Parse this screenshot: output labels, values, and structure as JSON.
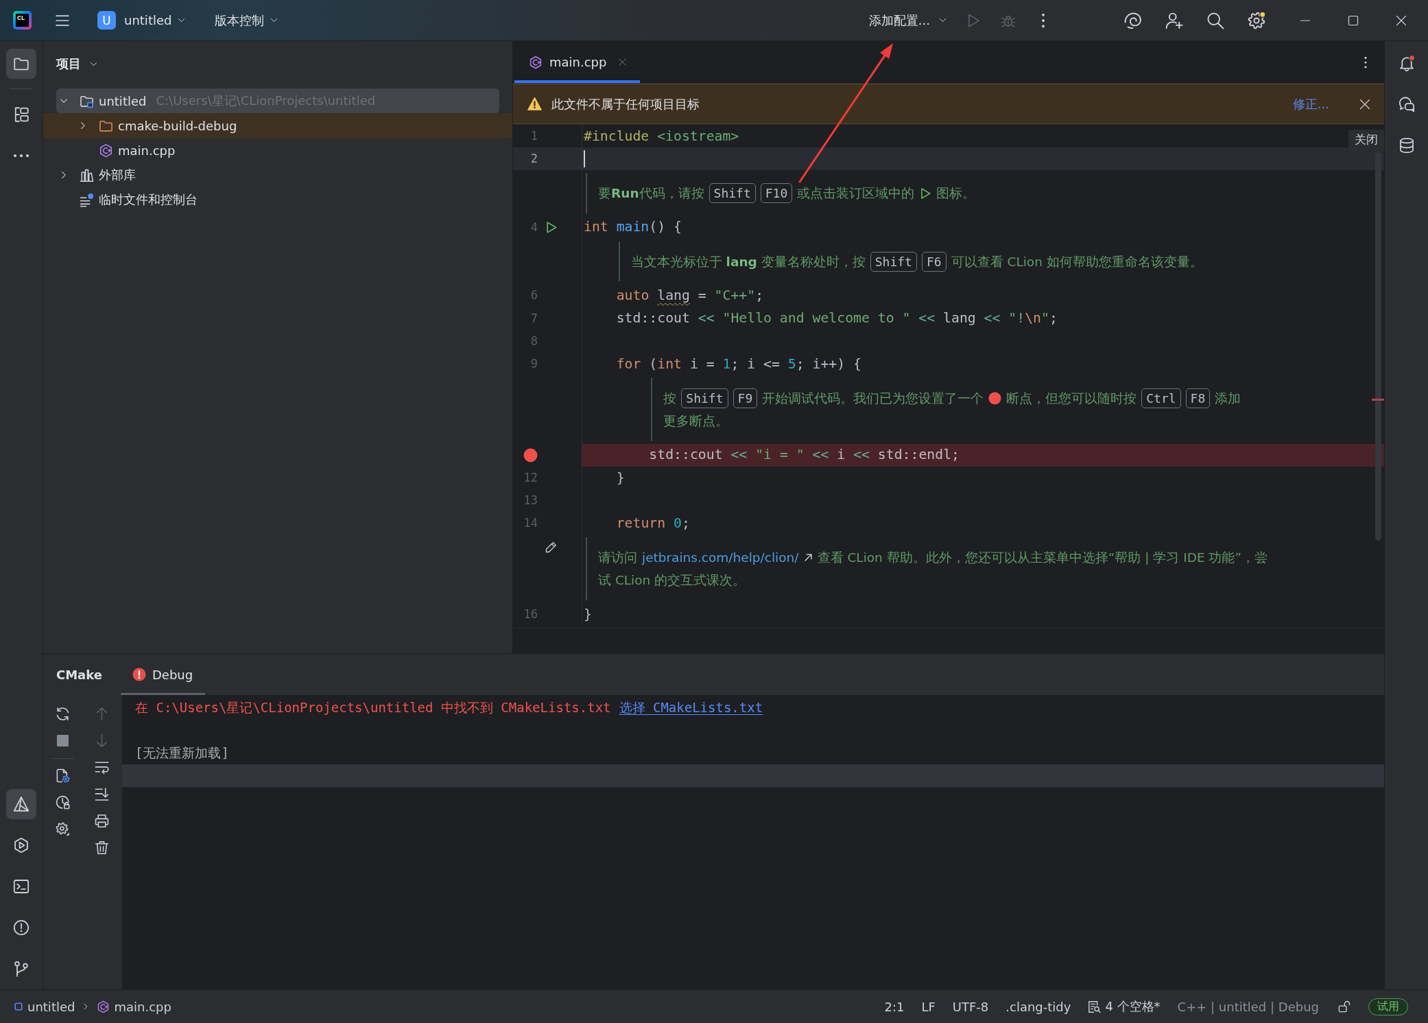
{
  "title_bar": {
    "logo_text": "CL",
    "project_badge": "U",
    "project_name": "untitled",
    "vcs_menu": "版本控制",
    "run_config": "添加配置...",
    "actions": [
      {
        "kind": "run",
        "disabled": true
      },
      {
        "kind": "debug",
        "disabled": true
      },
      {
        "kind": "more"
      }
    ],
    "tools": [
      {
        "kind": "ai",
        "badge": false
      },
      {
        "kind": "add-user",
        "badge": false
      },
      {
        "kind": "search",
        "badge": false
      },
      {
        "kind": "settings",
        "badge": true
      }
    ]
  },
  "tool_strip": {
    "top": [
      {
        "kind": "project",
        "selected": true
      },
      {
        "kind": "structure",
        "selected": false
      },
      {
        "kind": "more",
        "selected": false
      }
    ],
    "bottom": [
      {
        "kind": "cmake",
        "selected": true
      },
      {
        "kind": "run",
        "selected": false
      },
      {
        "kind": "terminal",
        "selected": false
      },
      {
        "kind": "problems",
        "selected": false
      },
      {
        "kind": "git",
        "selected": false
      }
    ]
  },
  "project_panel": {
    "title": "项目",
    "tree": [
      {
        "kind": "project",
        "label": "untitled",
        "path": "C:\\Users\\星记\\CLionProjects\\untitled",
        "expanded": true,
        "selected": true,
        "excluded": false,
        "children": [
          {
            "kind": "folder",
            "label": "cmake-build-debug",
            "expanded": false,
            "selected": false,
            "excluded": true
          },
          {
            "kind": "cpp",
            "label": "main.cpp",
            "selected": false,
            "excluded": false
          }
        ]
      },
      {
        "kind": "library",
        "label": "外部库",
        "expanded": false,
        "selected": false,
        "excluded": false
      },
      {
        "kind": "scratch",
        "label": "临时文件和控制台",
        "selected": false,
        "excluded": false
      }
    ]
  },
  "editor": {
    "tabs": [
      {
        "kind": "cpp",
        "label": "main.cpp",
        "selected": true
      }
    ],
    "banner": {
      "message": "此文件不属于任何项目目标",
      "action": "修正...",
      "close_tooltip": "关闭"
    },
    "lines": [
      {
        "kind": "code",
        "number": "1",
        "current": false,
        "breakpoint": false,
        "runnable": false,
        "tokens": [
          {
            "kind": "directive",
            "text": "#include "
          },
          {
            "kind": "header",
            "text": "<iostream>"
          }
        ]
      },
      {
        "kind": "code",
        "number": "2",
        "current": true,
        "breakpoint": false,
        "runnable": false
      },
      {
        "kind": "doc",
        "editable": false,
        "rows": [
          [
            {
              "kind": "text",
              "text": "要**Run**代码，请按"
            },
            {
              "kind": "key",
              "text": "Shift"
            },
            {
              "kind": "key",
              "text": "F10"
            },
            {
              "kind": "text",
              "text": "或点击装订区域中的"
            },
            {
              "kind": "run-icon"
            },
            {
              "kind": "text",
              "text": "图标。"
            }
          ]
        ]
      },
      {
        "kind": "code",
        "number": "4",
        "current": false,
        "breakpoint": false,
        "runnable": true,
        "tokens": [
          {
            "kind": "keyword",
            "text": "int "
          },
          {
            "kind": "function",
            "text": "main"
          },
          {
            "kind": "plain",
            "text": "() {"
          }
        ],
        "children": [
          {
            "kind": "doc",
            "editable": false,
            "rows": [
              [
                {
                  "kind": "text",
                  "text": "当文本光标位于 **lang** 变量名称处时，按"
                },
                {
                  "kind": "key",
                  "text": "Shift"
                },
                {
                  "kind": "key",
                  "text": "F6"
                },
                {
                  "kind": "text",
                  "text": "可以查看 CLion 如何帮助您重命名该变量。"
                }
              ]
            ]
          },
          {
            "kind": "code",
            "number": "6",
            "current": false,
            "breakpoint": false,
            "runnable": false,
            "tokens": [
              {
                "kind": "keyword",
                "text": "auto "
              },
              {
                "kind": "warned",
                "text": "lang"
              },
              {
                "kind": "plain",
                "text": " = "
              },
              {
                "kind": "string",
                "text": "\"C++\""
              },
              {
                "kind": "plain",
                "text": ";"
              }
            ]
          },
          {
            "kind": "code",
            "number": "7",
            "current": false,
            "breakpoint": false,
            "runnable": false,
            "tokens": [
              {
                "kind": "plain",
                "text": "std::cout"
              },
              {
                "kind": "operator",
                "text": " << "
              },
              {
                "kind": "string",
                "text": "\"Hello and welcome to \""
              },
              {
                "kind": "operator",
                "text": " << "
              },
              {
                "kind": "plain",
                "text": "lang"
              },
              {
                "kind": "operator",
                "text": " << "
              },
              {
                "kind": "string",
                "text": "\"!"
              },
              {
                "kind": "escape",
                "text": "\\n"
              },
              {
                "kind": "string",
                "text": "\""
              },
              {
                "kind": "plain",
                "text": ";"
              }
            ]
          },
          {
            "kind": "code",
            "number": "8",
            "current": false,
            "breakpoint": false,
            "runnable": false
          },
          {
            "kind": "code",
            "number": "9",
            "current": false,
            "breakpoint": false,
            "runnable": false,
            "tokens": [
              {
                "kind": "keyword",
                "text": "for"
              },
              {
                "kind": "plain",
                "text": " ("
              },
              {
                "kind": "keyword",
                "text": "int"
              },
              {
                "kind": "plain",
                "text": " i = "
              },
              {
                "kind": "number",
                "text": "1"
              },
              {
                "kind": "plain",
                "text": "; i <= "
              },
              {
                "kind": "number",
                "text": "5"
              },
              {
                "kind": "plain",
                "text": "; i++) {"
              }
            ],
            "children": [
              {
                "kind": "doc",
                "editable": false,
                "rows": [
                  [
                    {
                      "kind": "text",
                      "text": "按"
                    },
                    {
                      "kind": "key",
                      "text": "Shift"
                    },
                    {
                      "kind": "key",
                      "text": "F9"
                    },
                    {
                      "kind": "text",
                      "text": "开始调试代码。我们已为您设置了一个"
                    },
                    {
                      "kind": "breakpoint-icon"
                    },
                    {
                      "kind": "text",
                      "text": "断点，但您可以随时按"
                    },
                    {
                      "kind": "key",
                      "text": "Ctrl"
                    },
                    {
                      "kind": "key",
                      "text": "F8"
                    },
                    {
                      "kind": "text",
                      "text": "添加"
                    }
                  ],
                  [
                    {
                      "kind": "text",
                      "text": "更多断点。"
                    }
                  ]
                ]
              },
              {
                "kind": "code",
                "current": false,
                "breakpoint": true,
                "runnable": false,
                "tokens": [
                  {
                    "kind": "plain",
                    "text": "std::cout"
                  },
                  {
                    "kind": "operator",
                    "text": " << "
                  },
                  {
                    "kind": "string",
                    "text": "\"i = \""
                  },
                  {
                    "kind": "operator",
                    "text": " << "
                  },
                  {
                    "kind": "plain",
                    "text": "i"
                  },
                  {
                    "kind": "operator",
                    "text": " << "
                  },
                  {
                    "kind": "plain",
                    "text": "std::endl"
                  },
                  {
                    "kind": "plain",
                    "text": ";"
                  }
                ]
              }
            ]
          },
          {
            "kind": "code",
            "number": "12",
            "current": false,
            "breakpoint": false,
            "runnable": false,
            "tokens": [
              {
                "kind": "plain",
                "text": "}"
              }
            ]
          },
          {
            "kind": "code",
            "number": "13",
            "current": false,
            "breakpoint": false,
            "runnable": false
          },
          {
            "kind": "code",
            "number": "14",
            "current": false,
            "breakpoint": false,
            "runnable": false,
            "tokens": [
              {
                "kind": "keyword",
                "text": "return "
              },
              {
                "kind": "number",
                "text": "0"
              },
              {
                "kind": "plain",
                "text": ";"
              }
            ]
          }
        ]
      },
      {
        "kind": "doc",
        "editable": true,
        "rows": [
          [
            {
              "kind": "text",
              "text": "请访问"
            },
            {
              "kind": "link",
              "text": "jetbrains.com/help/clion/"
            },
            {
              "kind": "external-link-icon"
            },
            {
              "kind": "text",
              "text": "查看 CLion 帮助。此外，您还可以从主菜单中选择“帮助 | 学习 IDE 功能”，尝"
            }
          ],
          [
            {
              "kind": "text",
              "text": "试 CLion 的交互式课次。"
            }
          ]
        ]
      },
      {
        "kind": "code",
        "number": "16",
        "current": false,
        "breakpoint": false,
        "runnable": false,
        "tokens": [
          {
            "kind": "plain",
            "text": "}"
          }
        ]
      }
    ]
  },
  "bottom_panel": {
    "title": "CMake",
    "tabs": [
      {
        "kind": "error",
        "label": "Debug",
        "selected": true
      }
    ],
    "toolbars": [
      [
        {
          "kind": "reload",
          "disabled": false
        },
        {
          "kind": "stop",
          "disabled": true
        },
        {
          "kind": "separator"
        },
        {
          "kind": "cmake-settings",
          "disabled": false
        },
        {
          "kind": "clock-lock",
          "disabled": false
        },
        {
          "kind": "settings",
          "disabled": false
        }
      ],
      [
        {
          "kind": "up",
          "disabled": true
        },
        {
          "kind": "down",
          "disabled": true
        },
        {
          "kind": "soft-wrap",
          "disabled": false
        },
        {
          "kind": "scroll-end",
          "disabled": false
        },
        {
          "kind": "print",
          "disabled": false
        },
        {
          "kind": "delete",
          "disabled": false
        }
      ]
    ],
    "console": [
      {
        "current": false,
        "segments": [
          {
            "kind": "error",
            "text": "在 C:\\Users\\星记\\CLionProjects\\untitled 中找不到 CMakeLists.txt"
          },
          {
            "kind": "link",
            "text": "选择 CMakeLists.txt"
          }
        ]
      },
      {
        "current": false
      },
      {
        "current": false,
        "segments": [
          {
            "kind": "status",
            "text": "[无法重新加载]"
          }
        ]
      },
      {
        "current": true
      }
    ]
  },
  "right_strip": [
    {
      "kind": "notifications",
      "badge": true
    },
    {
      "kind": "ai-chat",
      "badge": false
    },
    {
      "kind": "database",
      "badge": false
    }
  ],
  "status_bar": {
    "breadcrumbs": [
      {
        "kind": "module",
        "label": "untitled"
      },
      {
        "kind": "cpp",
        "label": "main.cpp"
      }
    ],
    "items": [
      {
        "kind": "text",
        "label": "2:1"
      },
      {
        "kind": "text",
        "label": "LF"
      },
      {
        "kind": "text",
        "label": "UTF-8"
      },
      {
        "kind": "text",
        "label": ".clang-tidy"
      },
      {
        "kind": "indent",
        "label": "4 个空格*"
      },
      {
        "kind": "muted",
        "label": "C++ | untitled | Debug"
      },
      {
        "kind": "lock"
      },
      {
        "kind": "license",
        "label": "试用"
      }
    ]
  }
}
